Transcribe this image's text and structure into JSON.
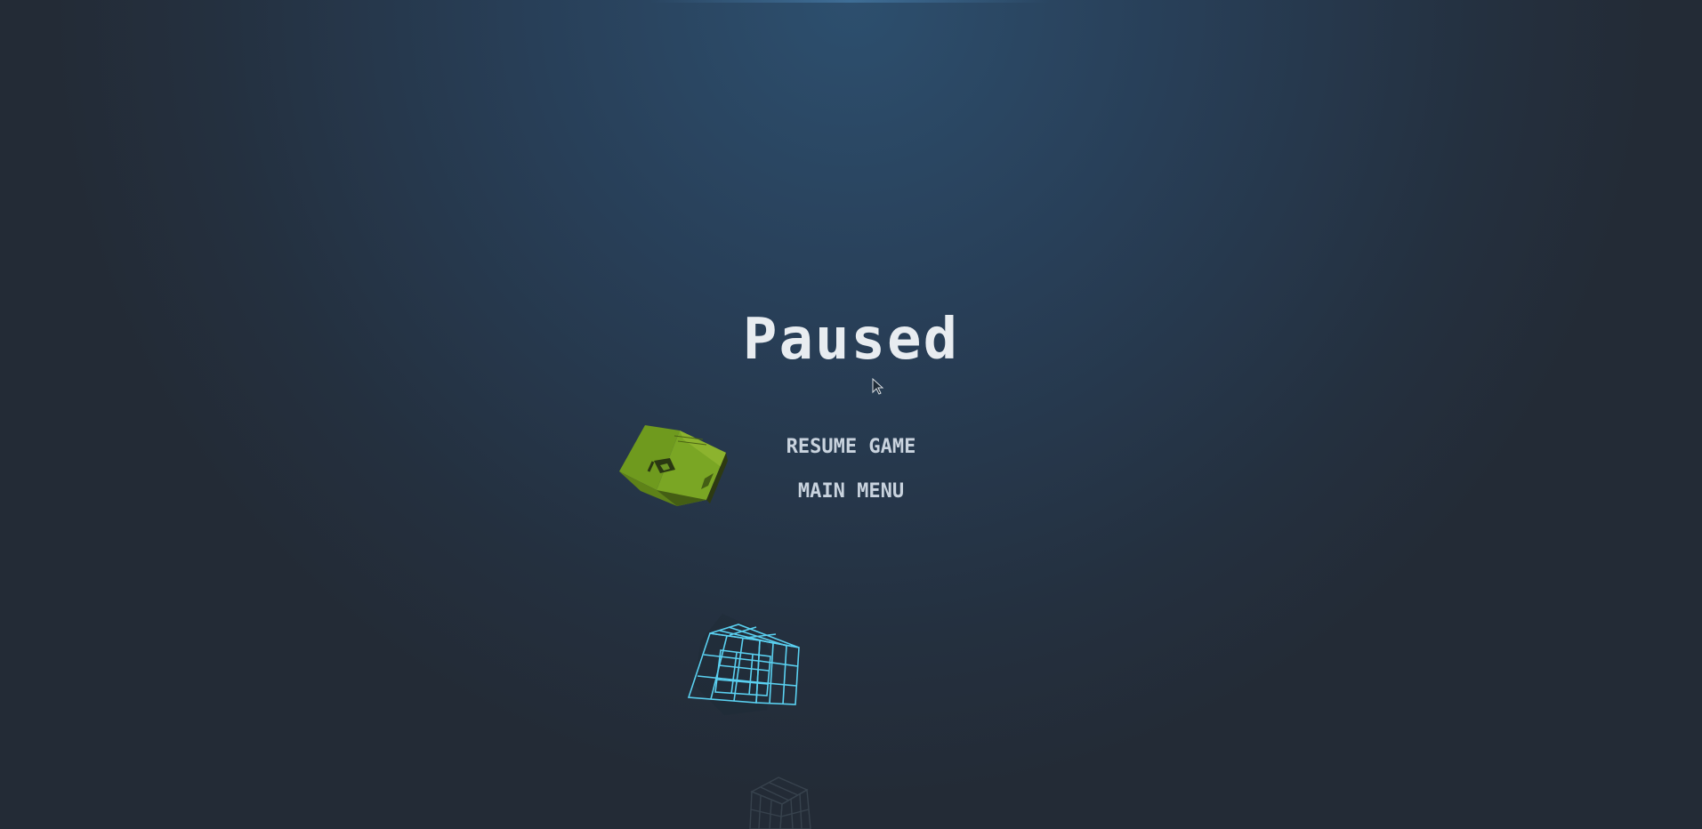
{
  "pause_menu": {
    "title": "Paused",
    "resume_label": "RESUME GAME",
    "main_menu_label": "MAIN MENU"
  },
  "colors": {
    "background_center": "#2d4f6e",
    "background_edge": "#232b36",
    "title_text": "#e8ecf0",
    "button_text": "#c9d3de",
    "green_cube": "#6f9a1e",
    "wire_cube": "#5ad0f0"
  },
  "icons": {
    "cursor": "arrow-cursor-icon",
    "green_cube": "solid-green-cube",
    "wire_cube": "wireframe-cyan-cube",
    "faint_cube": "faint-wireframe-cube"
  }
}
